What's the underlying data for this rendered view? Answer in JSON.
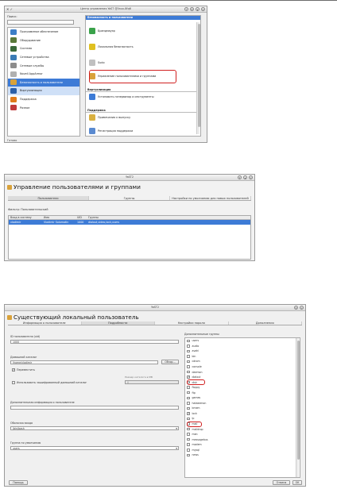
{
  "window1": {
    "title": "Центр управления YaST @linux-8fq6",
    "search_label": "Поиск:",
    "status": "Готово",
    "categories": [
      {
        "label": "Программное обеспечение",
        "icon": "software-icon",
        "color": "#3d7fc7"
      },
      {
        "label": "Оборудование",
        "icon": "hardware-icon",
        "color": "#5a7a3a"
      },
      {
        "label": "Система",
        "icon": "system-icon",
        "color": "#3a6a3a"
      },
      {
        "label": "Сетевые устройства",
        "icon": "network-devices-icon",
        "color": "#3a7bb5"
      },
      {
        "label": "Сетевые службы",
        "icon": "network-services-icon",
        "color": "#8c8c8c"
      },
      {
        "label": "Novell AppArmor",
        "icon": "apparmor-icon",
        "color": "#b0b0b0"
      },
      {
        "label": "Безопасность и пользователи",
        "icon": "security-users-icon",
        "color": "#d9a23a"
      },
      {
        "label": "Виртуализация",
        "icon": "virtualization-icon",
        "color": "#2b5fa8"
      },
      {
        "label": "Поддержка",
        "icon": "support-icon",
        "color": "#e07a1a"
      },
      {
        "label": "Разное",
        "icon": "misc-icon",
        "color": "#c03a3a"
      }
    ],
    "section_security": "Безопасность и пользователи",
    "modules_security": [
      {
        "label": "Брандмауэр",
        "icon": "firewall-icon",
        "color": "#3aa24a"
      },
      {
        "label": "Локальная безопасность",
        "icon": "local-security-icon",
        "color": "#e0c020"
      },
      {
        "label": "Sudo",
        "icon": "sudo-icon",
        "color": "#c0c0c0"
      },
      {
        "label": "Управление пользователями и группами",
        "icon": "users-groups-icon",
        "color": "#d9a23a"
      }
    ],
    "section_virtualization": "Виртуализация",
    "modules_virtualization": [
      {
        "label": "Установить гипервизор и инструменты",
        "icon": "hypervisor-icon",
        "color": "#3d7bd6"
      }
    ],
    "section_support": "Поддержка",
    "modules_support": [
      {
        "label": "Примечания к выпуску",
        "icon": "release-notes-icon",
        "color": "#d9b040"
      },
      {
        "label": "Регистрация поддержки",
        "icon": "support-registration-icon",
        "color": "#5a8ad0"
      }
    ]
  },
  "window2": {
    "title": "YaST2",
    "app_title": "Управление пользователями и группами",
    "tabs": [
      "Пользователи",
      "Группы",
      "Настройки по умолчанию для новых пользователей"
    ],
    "filter": "Фильтр: Пользовательский",
    "columns": [
      "Вход в систему",
      "Имя",
      "UID",
      "Группы"
    ],
    "rows": [
      {
        "login": "vladimir",
        "name": "Vladimir Solomatin",
        "uid": "1000",
        "groups": "dialout,video,lock,users"
      }
    ]
  },
  "window3": {
    "title": "YaST2",
    "app_title": "Существующий локальный пользователь",
    "tabs": [
      "Информация о пользователе",
      "Подробности",
      "Настройки пароля",
      "Дополнения"
    ],
    "uid_label": "ID пользователя (uid)",
    "uid_value": "1000",
    "home_label": "Домашний каталог",
    "home_value": "/home/vladimir",
    "browse_button": "Обзор...",
    "move_label": "Переместить",
    "encrypted_label": "Использовать зашифрованный домашний каталог",
    "size_label": "Размер каталога в MB",
    "size_value": "0",
    "additional_label": "Дополнительная информация о пользователе",
    "login_shell_label": "Оболочка входа",
    "login_shell_value": "/bin/bash",
    "default_group_label": "Группа по умолчанию",
    "default_group_value": "users",
    "groups_label": "Дополнительные группы",
    "groups": [
      {
        "name": "users",
        "checked": false
      },
      {
        "name": "audio",
        "checked": false
      },
      {
        "name": "avahi",
        "checked": false
      },
      {
        "name": "bin",
        "checked": false
      },
      {
        "name": "cdrom",
        "checked": false
      },
      {
        "name": "console",
        "checked": false
      },
      {
        "name": "daemon",
        "checked": false
      },
      {
        "name": "dialout",
        "checked": true
      },
      {
        "name": "disk",
        "checked": false
      },
      {
        "name": "floppy",
        "checked": false
      },
      {
        "name": "ftp",
        "checked": false
      },
      {
        "name": "games",
        "checked": false
      },
      {
        "name": "haldaemon",
        "checked": false
      },
      {
        "name": "kmem",
        "checked": false
      },
      {
        "name": "lock",
        "checked": true
      },
      {
        "name": "lp",
        "checked": false
      },
      {
        "name": "mail",
        "checked": false
      },
      {
        "name": "maildrop",
        "checked": false
      },
      {
        "name": "man",
        "checked": false
      },
      {
        "name": "messagebus",
        "checked": false
      },
      {
        "name": "modem",
        "checked": false
      },
      {
        "name": "mysql",
        "checked": false
      },
      {
        "name": "news",
        "checked": false
      }
    ],
    "help_button": "Помощь",
    "cancel_button": "Отмена",
    "ok_button": "ОК"
  }
}
